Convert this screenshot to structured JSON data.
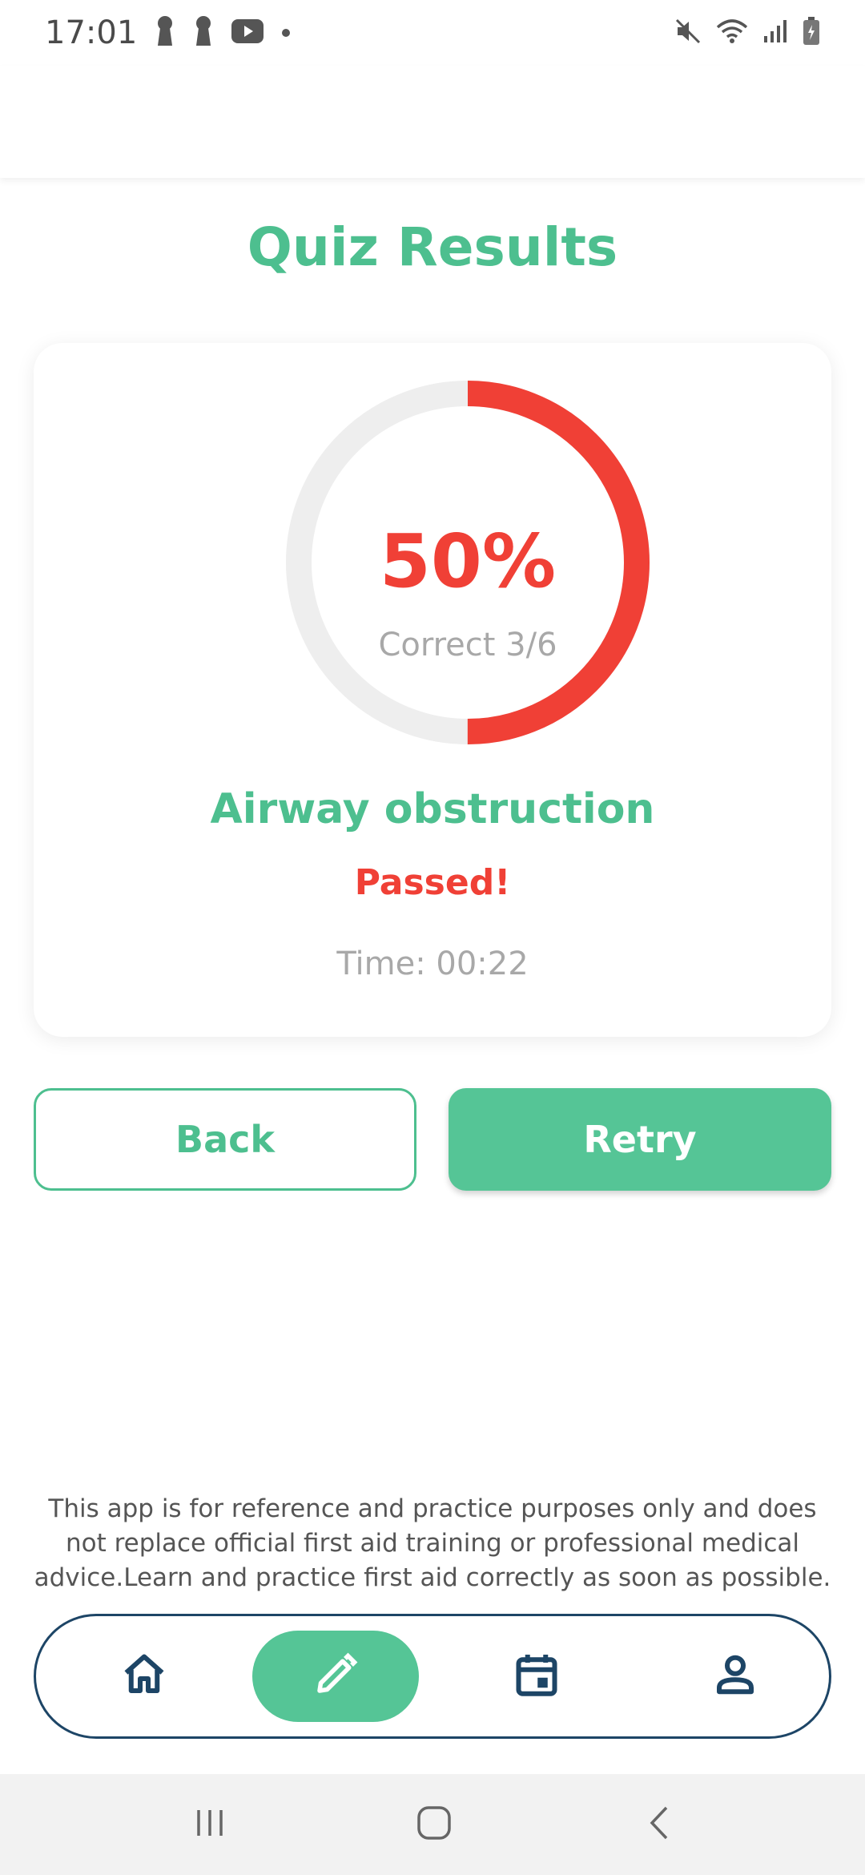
{
  "status_bar": {
    "time": "17:01"
  },
  "page": {
    "title": "Quiz Results"
  },
  "result": {
    "score_percent_label": "50%",
    "score_fraction": 0.5,
    "correct_label": "Correct 3/6",
    "topic": "Airway obstruction",
    "status": "Passed!",
    "time_label": "Time: 00:22"
  },
  "buttons": {
    "back_label": "Back",
    "retry_label": "Retry"
  },
  "disclaimer": "This app is for reference and practice purposes only and does not replace official first aid training or professional medical advice.Learn and practice first aid correctly as soon as possible.",
  "bottom_nav": {
    "items": [
      {
        "icon": "home-icon",
        "active": false
      },
      {
        "icon": "pencil-icon",
        "active": true
      },
      {
        "icon": "calendar-icon",
        "active": false
      },
      {
        "icon": "person-icon",
        "active": false
      }
    ]
  },
  "colors": {
    "accent_green": "#4dbf8f",
    "score_red": "#f04036",
    "nav_border": "#1d4566",
    "ring_track": "#eeeeee"
  }
}
